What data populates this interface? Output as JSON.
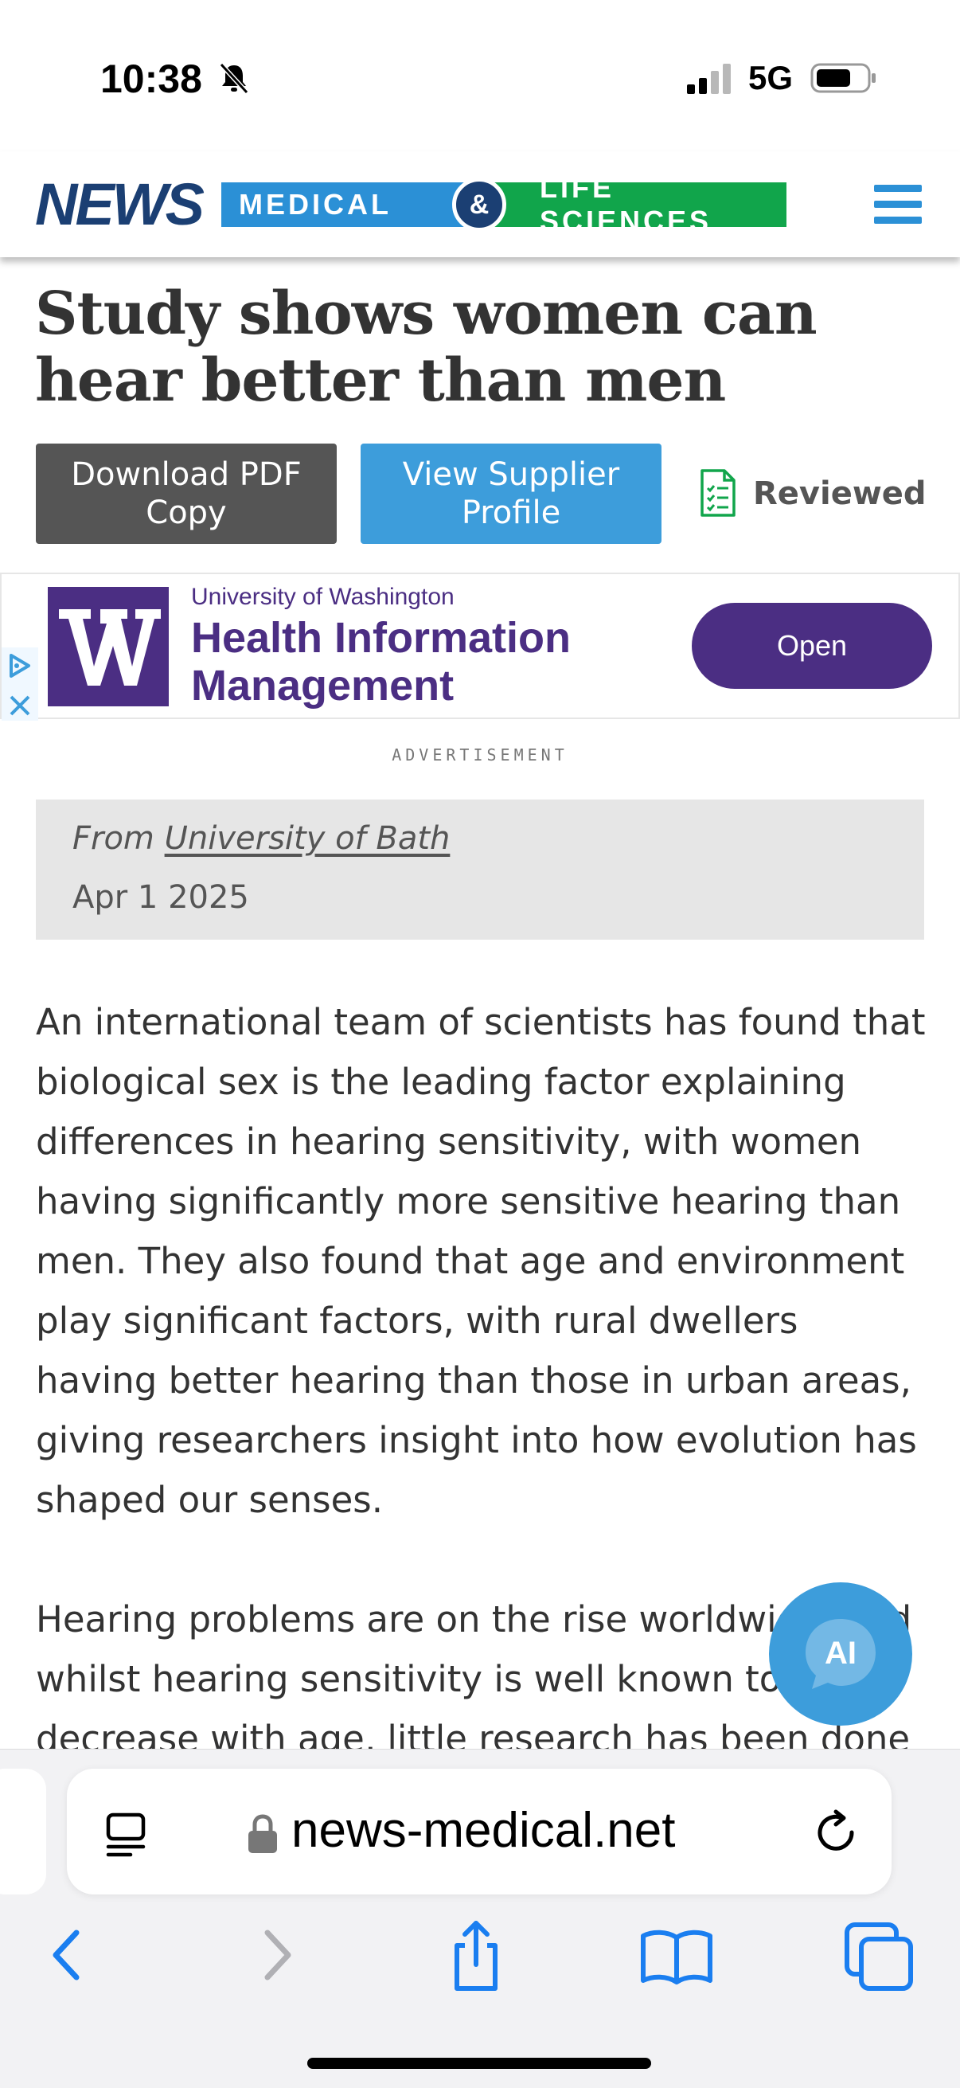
{
  "status_bar": {
    "time": "10:38",
    "network": "5G"
  },
  "site": {
    "logo_news": "NEWS",
    "logo_medical": "MEDICAL",
    "logo_amp": "&",
    "logo_life": "LIFE SCIENCES"
  },
  "article": {
    "title": "Study shows women can hear better than men",
    "buttons": {
      "download_pdf": "Download PDF Copy",
      "view_supplier": "View Supplier Profile",
      "reviewed": "Reviewed"
    },
    "source_prefix": "From",
    "source_name": "University of Bath",
    "date": "Apr 1 2025",
    "paragraphs": [
      "An international team of scientists has found that biological sex is the leading factor explaining differences in hearing sensitivity, with women having significantly more sensitive hearing than men. They also found that age and environment play significant factors, with rural dwellers having better hearing than those in urban areas, giving researchers insight into how evolution has shaped our senses.",
      "Hearing problems are on the rise worldwide, and whilst hearing sensitivity is well known to decrease with age, little research has been done"
    ]
  },
  "ad": {
    "org": "University of Washington",
    "headline": "Health Information Management",
    "cta": "Open",
    "label": "ADVERTISEMENT",
    "brand_color": "#4b2e83"
  },
  "ai_button": {
    "label": "AI"
  },
  "browser": {
    "url": "news-medical.net"
  },
  "colors": {
    "accent_blue": "#3d9ddb",
    "brand_green": "#11a54b",
    "brand_navy": "#1b3f73"
  }
}
